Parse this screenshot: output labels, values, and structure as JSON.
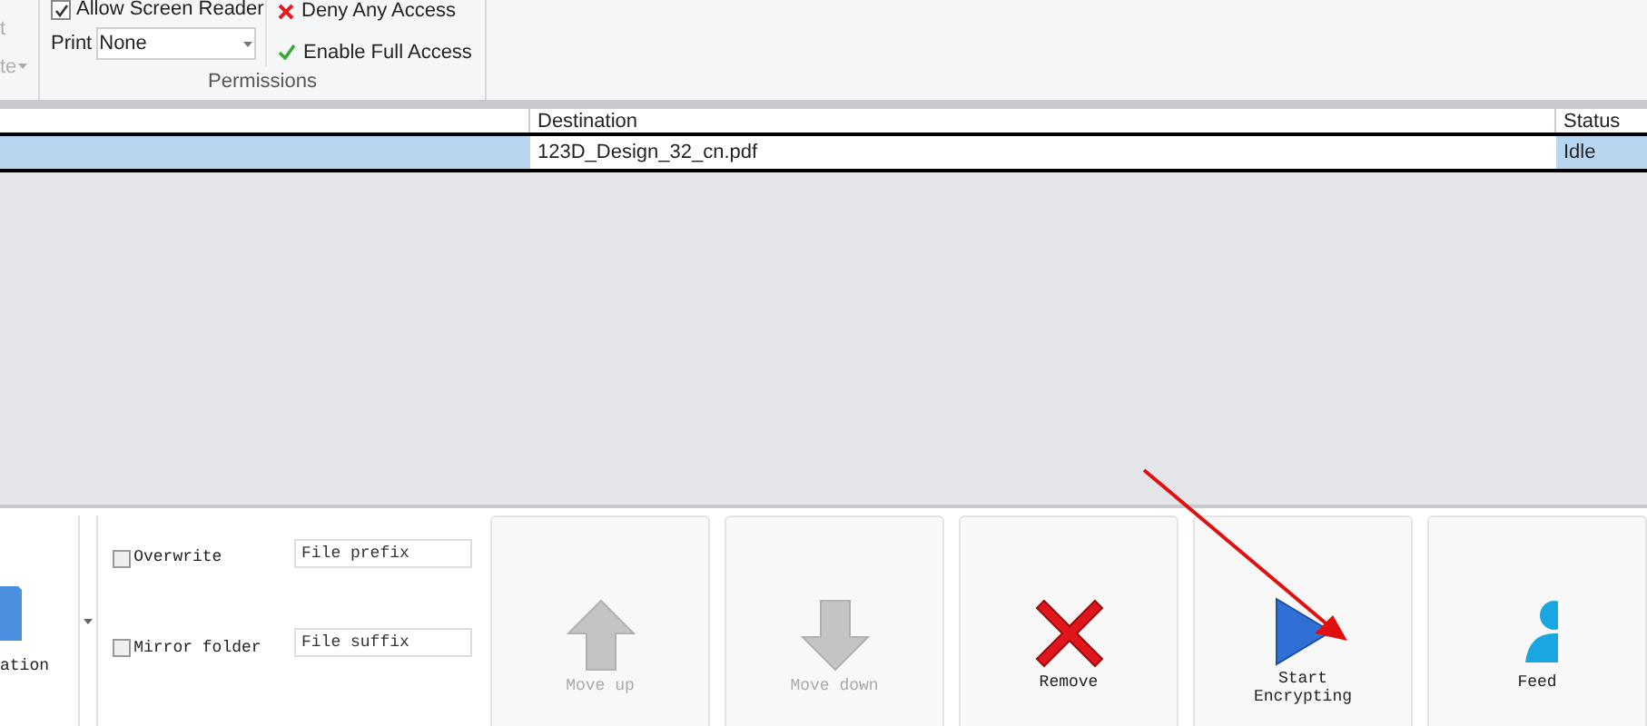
{
  "ribbon": {
    "cut_group": {
      "labels": [
        "t",
        "te"
      ]
    },
    "permissions": {
      "allow_screen_reader": {
        "label": "Allow Screen Reader",
        "checked": true
      },
      "print": {
        "label": "Print",
        "value": "None"
      },
      "actions": [
        {
          "kind": "deny",
          "label": "Deny Any Access"
        },
        {
          "kind": "enable",
          "label": "Enable Full Access"
        }
      ],
      "title": "Permissions"
    }
  },
  "table": {
    "columns": [
      "Destination",
      "Status"
    ],
    "rows": [
      {
        "destination": "123D_Design_32_cn.pdf",
        "status": "Idle",
        "selected": true
      }
    ]
  },
  "bottom": {
    "cut_button": {
      "label": "ation"
    },
    "options": [
      {
        "label": "Overwrite",
        "checked": false
      },
      {
        "label": "Mirror folder",
        "checked": false
      }
    ],
    "fields": [
      {
        "placeholder": "File prefix"
      },
      {
        "placeholder": "File suffix"
      }
    ],
    "buttons": [
      {
        "kind": "up",
        "label": "Move up",
        "disabled": true
      },
      {
        "kind": "down",
        "label": "Move down",
        "disabled": true
      },
      {
        "kind": "remove",
        "label": "Remove",
        "disabled": false
      },
      {
        "kind": "start",
        "label": "Start Encrypting",
        "disabled": false
      },
      {
        "kind": "feedback",
        "label": "Feed",
        "disabled": false
      }
    ]
  }
}
